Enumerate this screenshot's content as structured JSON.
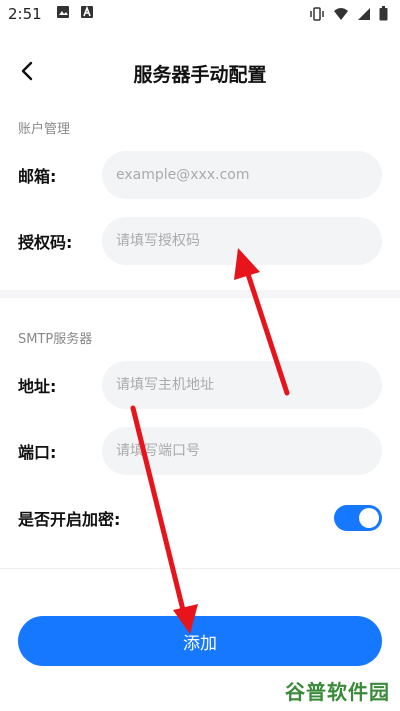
{
  "status_bar": {
    "time": "2:51",
    "left_icons": [
      "gallery-icon",
      "a-icon"
    ],
    "right_icons": [
      "vibrate-icon",
      "wifi-icon",
      "signal-icon",
      "battery-icon"
    ]
  },
  "header": {
    "title": "服务器手动配置",
    "back_icon": "chevron-left-icon"
  },
  "account_section": {
    "label": "账户管理",
    "email": {
      "label": "邮箱:",
      "value": "",
      "placeholder": "example@xxx.com"
    },
    "auth_code": {
      "label": "授权码:",
      "value": "",
      "placeholder": "请填写授权码"
    }
  },
  "smtp_section": {
    "label": "SMTP服务器",
    "address": {
      "label": "地址:",
      "value": "",
      "placeholder": "请填写主机地址"
    },
    "port": {
      "label": "端口:",
      "value": "",
      "placeholder": "请填写端口号"
    },
    "encryption": {
      "label": "是否开启加密:",
      "enabled": true
    }
  },
  "add_button": {
    "label": "添加"
  },
  "watermark": {
    "text": "谷普软件园"
  },
  "colors": {
    "accent": "#1677ff",
    "arrow": "#e8141c",
    "field_bg": "#f3f4f6"
  }
}
